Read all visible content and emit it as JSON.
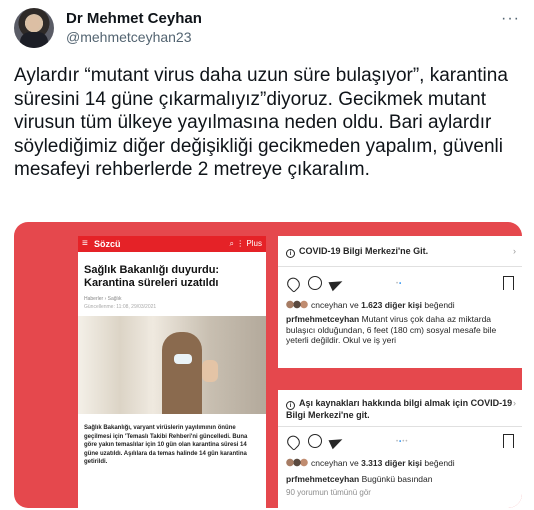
{
  "author": {
    "name": "Dr Mehmet Ceyhan",
    "handle": "@mehmetceyhan23",
    "more_icon": "more-horizontal-icon"
  },
  "tweet_text": "Aylardır “mutant virus daha uzun süre bulaşıyor”, karantina süresini 14 güne çıkarmalıyız”diyoruz. Gecikmek mutant virusun tüm ülkeye yayılmasına neden oldu. Bari aylardır söylediğimiz diğer değişikliği gecikmeden yapalım, güvenli mesafeyi rehberlerde 2 metreye çıkaralım.",
  "media": {
    "background_color": "#e5484d",
    "news": {
      "logo": "Sözcü",
      "header_icons": "⌕  ⋮  Plus",
      "title": "Sağlık Bakanlığı duyurdu: Karantina süreleri uzatıldı",
      "meta": "Haberler  ›  Sağlık",
      "date": "Güncellenme: 11:08, 29/03/2021",
      "body": "Sağlık Bakanlığı, varyant virüslerin yayılımının önüne geçilmesi için 'Temaslı Takibi Rehberi'ni güncelledi. Buna göre yakın temaslılar için 10 gün olan karantina süresi 14 güne uzatıldı. Aşılılara da temas halinde 14 gün karantina getirildi."
    },
    "insta1": {
      "covid_link": "COVID-19 Bilgi Merkezi'ne Git.",
      "likes_user": "cnceyhan",
      "likes_rest": " ve ",
      "likes_count": "1.623 diğer kişi",
      "likes_suffix": " beğendi",
      "caption_user": "prfmehmetceyhan",
      "caption_text": " Mutant virus çok daha az miktarda bulaşıcı olduğundan, 6 feet (180 cm) sosyal mesafe bile yeterli değildir. Okul ve iş yeri"
    },
    "insta2": {
      "covid_link": "Aşı kaynakları hakkında bilgi almak için COVID-19 Bilgi Merkezi'ne git.",
      "likes_user": "cnceyhan",
      "likes_rest": " ve ",
      "likes_count": "3.313 diğer kişi",
      "likes_suffix": " beğendi",
      "caption_user": "prfmehmetceyhan",
      "caption_text": " Bugünkü basından",
      "comments": "90 yorumun tümünü gör"
    }
  }
}
